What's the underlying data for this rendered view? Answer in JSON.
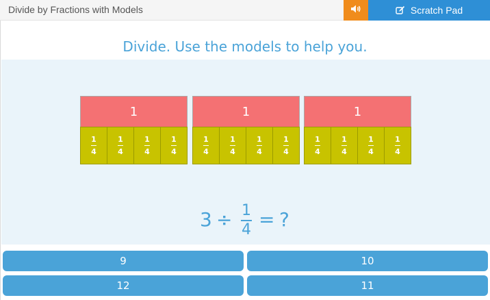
{
  "header": {
    "title": "Divide by Fractions with Models",
    "sound_icon": "speaker-icon",
    "scratch_label": "Scratch Pad",
    "scratch_icon": "edit-icon"
  },
  "instruction": "Divide. Use the models to help you.",
  "models": [
    {
      "whole_label": "1",
      "parts": [
        {
          "num": "1",
          "den": "4"
        },
        {
          "num": "1",
          "den": "4"
        },
        {
          "num": "1",
          "den": "4"
        },
        {
          "num": "1",
          "den": "4"
        }
      ]
    },
    {
      "whole_label": "1",
      "parts": [
        {
          "num": "1",
          "den": "4"
        },
        {
          "num": "1",
          "den": "4"
        },
        {
          "num": "1",
          "den": "4"
        },
        {
          "num": "1",
          "den": "4"
        }
      ]
    },
    {
      "whole_label": "1",
      "parts": [
        {
          "num": "1",
          "den": "4"
        },
        {
          "num": "1",
          "den": "4"
        },
        {
          "num": "1",
          "den": "4"
        },
        {
          "num": "1",
          "den": "4"
        }
      ]
    }
  ],
  "equation": {
    "whole": "3",
    "operator": "÷",
    "numerator": "1",
    "denominator": "4",
    "equals": "=",
    "unknown": "?"
  },
  "answers": [
    "9",
    "10",
    "12",
    "11"
  ],
  "colors": {
    "accent": "#4aa3d8",
    "whole_bar": "#f47173",
    "fraction_bar": "#c8c300",
    "sound_button": "#f08c1c",
    "scratch_button": "#2e8fd6"
  }
}
